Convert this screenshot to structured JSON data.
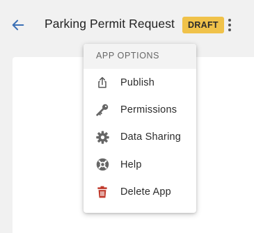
{
  "header": {
    "back_icon": "arrow-left-icon",
    "title": "Parking Permit Request",
    "status_badge": "DRAFT",
    "more_icon": "more-vertical-icon"
  },
  "menu": {
    "heading": "APP OPTIONS",
    "items": [
      {
        "label": "Publish",
        "icon": "share-upload-icon"
      },
      {
        "label": "Permissions",
        "icon": "key-icon"
      },
      {
        "label": "Data Sharing",
        "icon": "gear-icon"
      },
      {
        "label": "Help",
        "icon": "lifebuoy-icon"
      },
      {
        "label": "Delete App",
        "icon": "trash-icon"
      }
    ]
  },
  "colors": {
    "accent": "#3a6fb5",
    "badge": "#f0c24a",
    "danger": "#c0392b",
    "icon": "#666666"
  }
}
